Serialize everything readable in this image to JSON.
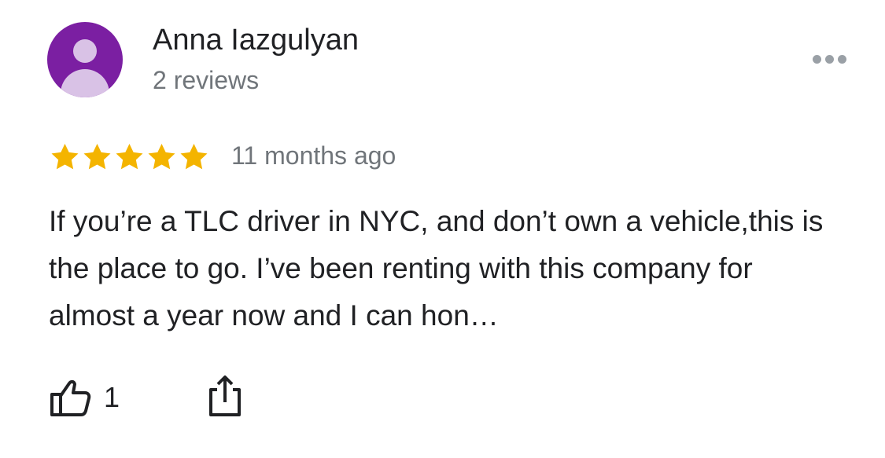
{
  "review": {
    "author_name": "Anna Iazgulyan",
    "review_count": "2 reviews",
    "rating": 5,
    "rating_max": 5,
    "date": "11 months ago",
    "text": "If you’re a TLC driver in NYC, and don’t own a vehicle,this is the place to go. I’ve been renting with this company for almost a year now and I can hon…",
    "like_count": "1"
  },
  "colors": {
    "avatar_bg": "#7b1fa2",
    "avatar_fg": "#d9c2e6",
    "star": "#f4b400",
    "secondary_text": "#70757a"
  },
  "icons": {
    "avatar": "person-silhouette-icon",
    "more": "more-horizontal-icon",
    "star": "star-icon",
    "like": "thumbs-up-icon",
    "share": "share-icon"
  }
}
